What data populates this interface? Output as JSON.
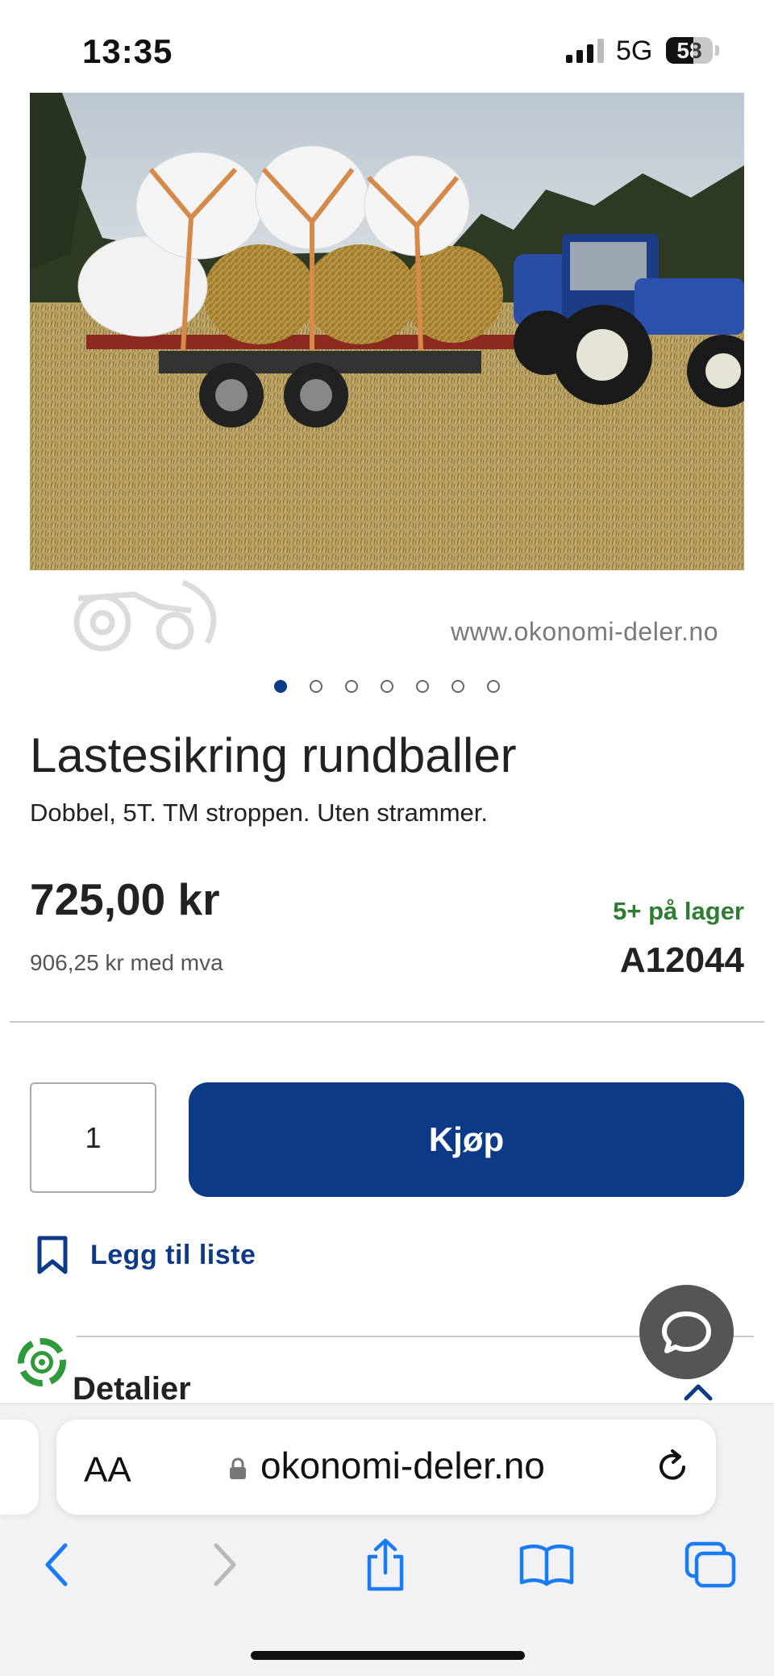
{
  "status_bar": {
    "time": "13:35",
    "network": "5G",
    "battery": "58",
    "battery_level": 0.58
  },
  "product": {
    "image_icon": "tractor-trailer-photo",
    "watermark_url": "www.okonomi-deler.no",
    "carousel": {
      "count": 7,
      "active_index": 0
    },
    "title": "Lastesikring rundballer",
    "subtitle": "Dobbel, 5T. TM stroppen. Uten strammer.",
    "price": "725,00 kr",
    "price_vat": "906,25 kr med mva",
    "stock": "5+ på lager",
    "sku": "A12044",
    "quantity": "1",
    "buy_label": "Kjøp",
    "wishlist_label": "Legg til liste",
    "details_label": "Detalier",
    "colors": {
      "brand": "#0c3a87",
      "stock": "#2e7d32"
    }
  },
  "icons": {
    "chat": "chat-bubble-icon",
    "eco": "eco-recycle-icon",
    "bookmark": "bookmark-icon",
    "chevron": "chevron-up-icon"
  },
  "browser": {
    "aa_label": "AA",
    "url": "okonomi-deler.no",
    "toolbar": [
      "back-icon",
      "forward-icon",
      "share-icon",
      "bookmarks-icon",
      "tabs-icon"
    ]
  }
}
